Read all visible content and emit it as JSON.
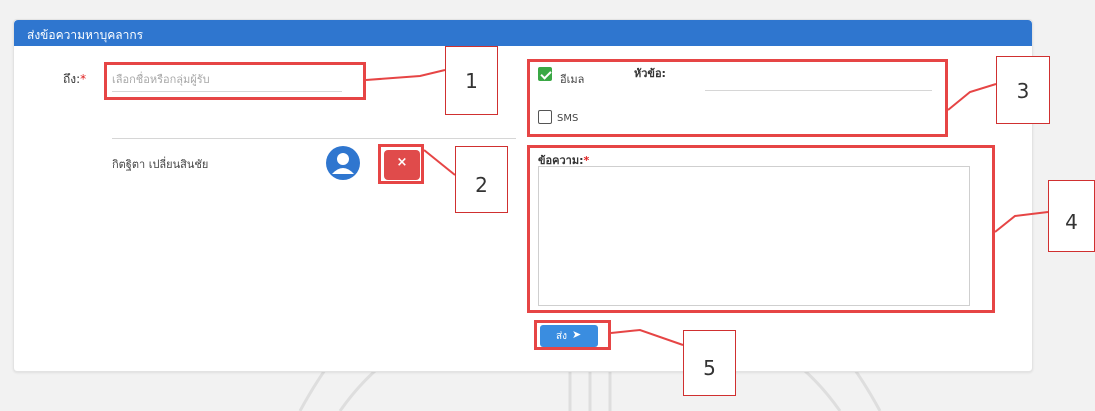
{
  "panel": {
    "title": "ส่งข้อความหาบุคลากร"
  },
  "to_field": {
    "label": "ถึง:",
    "required_mark": "*",
    "placeholder": "เลือกชื่อหรือกลุ่มผู้รับ"
  },
  "recipient": {
    "name": "กิตฐิตา เปลี่ยนสินชัย",
    "avatar_icon": "user-avatar-icon",
    "remove_icon": "close-icon",
    "remove_label": "×"
  },
  "channels": {
    "email": {
      "label": "อีเมล",
      "checked": true
    },
    "sms": {
      "label": "SMS",
      "checked": false
    }
  },
  "subject": {
    "label": "หัวข้อ:"
  },
  "message": {
    "label": "ข้อความ:",
    "required_mark": "*"
  },
  "send_button": {
    "label": "ส่ง",
    "icon": "paper-plane-icon"
  },
  "callouts": [
    "1",
    "2",
    "3",
    "4",
    "5"
  ],
  "colors": {
    "header": "#2f76cf",
    "callout": "#e64545",
    "check": "#3aa845",
    "remove": "#e04b4b",
    "send": "#3a8de0"
  }
}
